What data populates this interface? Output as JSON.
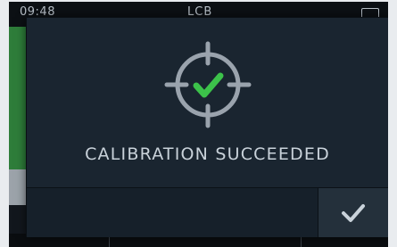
{
  "status_bar": {
    "time": "09:48",
    "title": "LCB",
    "battery_icon": "battery-icon"
  },
  "dialog": {
    "icon": "crosshair-check-icon",
    "message": "CALIBRATION SUCCEEDED",
    "confirm_icon": "check-icon"
  },
  "colors": {
    "dialog_background": "#1a2530",
    "check_accent": "#3cc24a",
    "crosshair": "#9aa3ad",
    "text": "#c9d2da",
    "background_green": "#2e7d3a"
  }
}
